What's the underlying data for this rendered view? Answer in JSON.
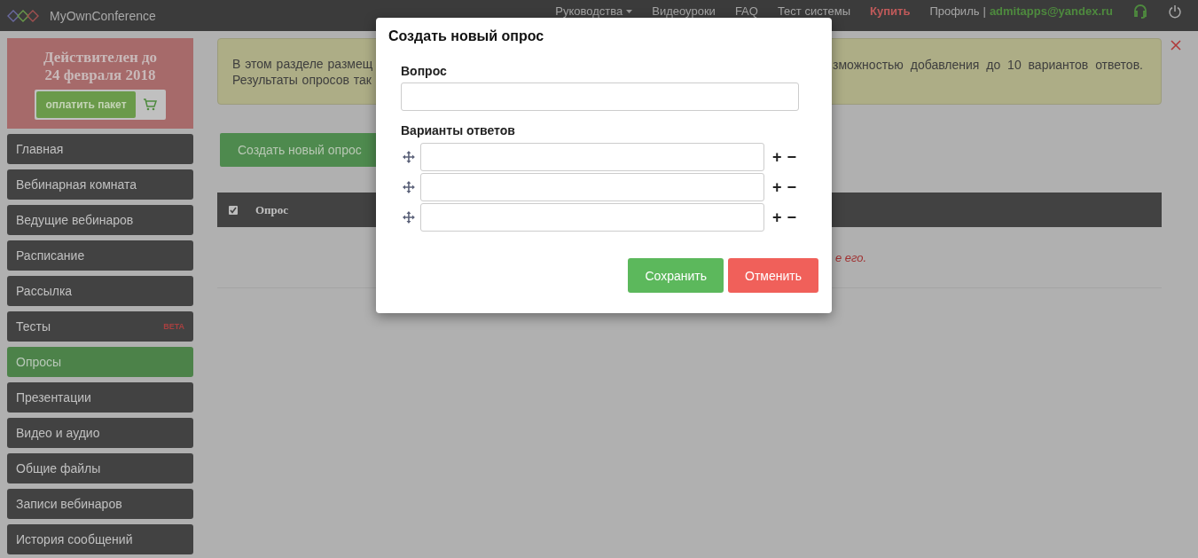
{
  "topbar": {
    "logo": "MyOwnConference",
    "nav": [
      {
        "label": "Руководства",
        "kind": "dropdown"
      },
      {
        "label": "Видеоуроки",
        "kind": "link"
      },
      {
        "label": "FAQ",
        "kind": "link"
      },
      {
        "label": "Тест системы",
        "kind": "link"
      },
      {
        "label": "Купить",
        "kind": "accent"
      }
    ],
    "profile": "Профиль",
    "separator": "|",
    "email": "admitapps@yandex.ru"
  },
  "sidebar": {
    "promo": {
      "title_lines": [
        "Действителен до",
        "24 февраля 2018"
      ],
      "button": "оплатить пакет"
    },
    "items": [
      {
        "label": "Главная",
        "selected": false
      },
      {
        "label": "Вебинарная комната",
        "selected": false
      },
      {
        "label": "Ведущие вебинаров",
        "selected": false
      },
      {
        "label": "Расписание",
        "selected": false
      },
      {
        "label": "Рассылка",
        "selected": false
      },
      {
        "label": "Тесты",
        "selected": false,
        "badge": "BETA"
      },
      {
        "label": "Опросы",
        "selected": true
      },
      {
        "label": "Презентации",
        "selected": false
      },
      {
        "label": "Видео и аудио",
        "selected": false
      },
      {
        "label": "Общие файлы",
        "selected": false
      },
      {
        "label": "Записи вебинаров",
        "selected": false
      },
      {
        "label": "История сообщений",
        "selected": false
      }
    ]
  },
  "alert": {
    "left_lines": [
      "В этом разделе размещ",
      "Результаты опросов так"
    ],
    "right_lines": [
      "зможностью добавления до 10 вариантов ответов."
    ]
  },
  "create_button": "Создать новый опрос",
  "table": {
    "select_all_checked": true,
    "columns": [
      "Опрос"
    ],
    "empty_message": "е его."
  },
  "modal": {
    "title": "Создать новый опрос",
    "question_label": "Вопрос",
    "answers_label": "Варианты ответов",
    "answers": [
      {
        "kind": "option"
      },
      {
        "kind": "option"
      },
      {
        "kind": "option"
      }
    ],
    "add_sign": "+",
    "remove_sign": "−",
    "buttons": [
      {
        "label": "Сохранить",
        "kind": "primary"
      },
      {
        "label": "Отменить",
        "kind": "danger"
      }
    ]
  }
}
